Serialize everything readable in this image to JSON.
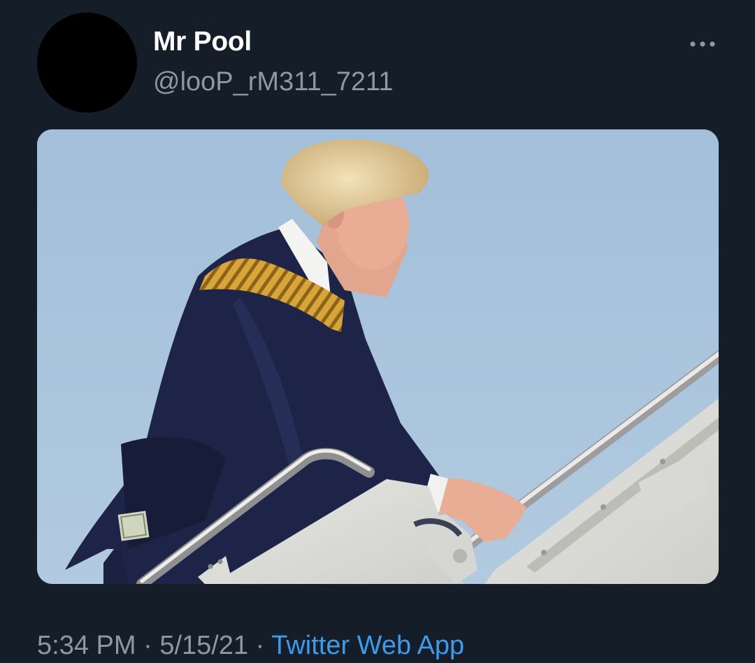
{
  "author": {
    "display_name": "Mr Pool",
    "handle": "@looP_rM311_7211"
  },
  "meta": {
    "time": "5:34 PM",
    "separator": "·",
    "date": "5/15/21",
    "source": "Twitter Web App"
  },
  "icons": {
    "more": "more-horizontal-icon"
  },
  "colors": {
    "background": "#151d28",
    "name": "#ffffff",
    "secondary_text": "#8b98a5",
    "link": "#3d9be9",
    "sky": "#a9c4dd"
  }
}
